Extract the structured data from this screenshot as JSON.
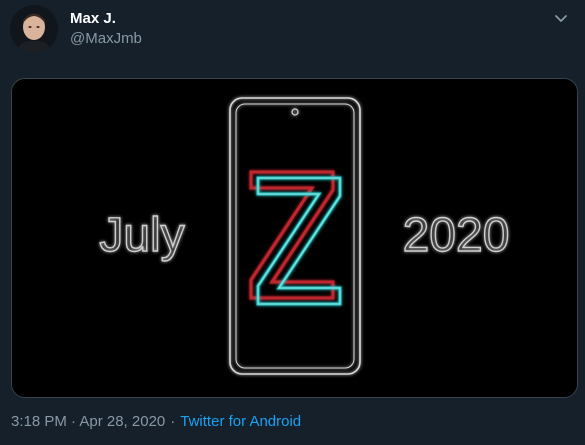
{
  "tweet": {
    "author_name": "Max J.",
    "author_handle": "@MaxJmb",
    "timestamp": "3:18 PM · Apr 28, 2020",
    "separator": "·",
    "source": "Twitter for Android"
  },
  "media": {
    "left_text": "July",
    "center_letter": "Z",
    "right_text": "2020"
  },
  "icons": {
    "caret": "chevron-down-icon",
    "avatar": "profile-photo"
  },
  "colors": {
    "background": "#15202b",
    "link": "#1da1f2",
    "secondary_text": "#8899a6",
    "neon_cyan": "#26c6c6",
    "neon_red": "#c0282d"
  }
}
